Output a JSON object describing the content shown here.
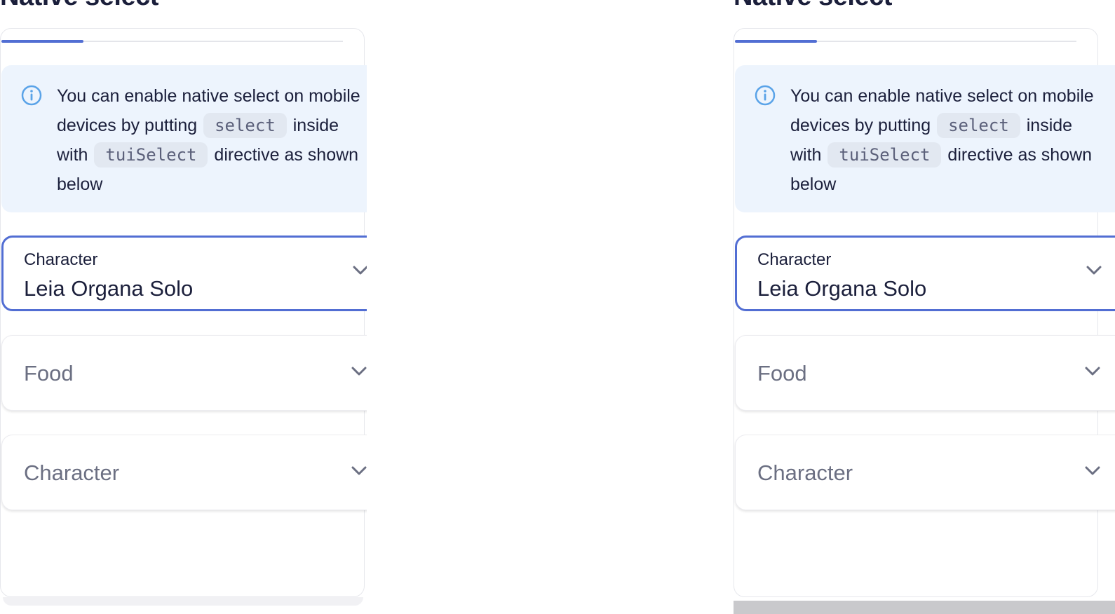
{
  "panels": [
    {
      "heading": "Native select",
      "notice": {
        "text_1": "You can enable native select on mobile devices by putting",
        "code_1": "select",
        "text_2": "inside with",
        "code_2": "tuiSelect",
        "text_3": "directive as shown below"
      },
      "fields": {
        "character": {
          "label": "Character",
          "value": "Leia Organa Solo"
        },
        "food": {
          "placeholder": "Food"
        },
        "character2": {
          "placeholder": "Character"
        }
      }
    },
    {
      "heading": "Native select",
      "notice": {
        "text_1": "You can enable native select on mobile devices by putting",
        "code_1": "select",
        "text_2": "inside with",
        "code_2": "tuiSelect",
        "text_3": "directive as shown below"
      },
      "fields": {
        "character": {
          "label": "Character",
          "value": "Leia Organa Solo"
        },
        "food": {
          "placeholder": "Food"
        },
        "character2": {
          "placeholder": "Character"
        }
      }
    }
  ],
  "colors": {
    "accent": "#526ed3",
    "notice_bg": "#edf4fd",
    "info_icon": "#5aa3e8"
  }
}
